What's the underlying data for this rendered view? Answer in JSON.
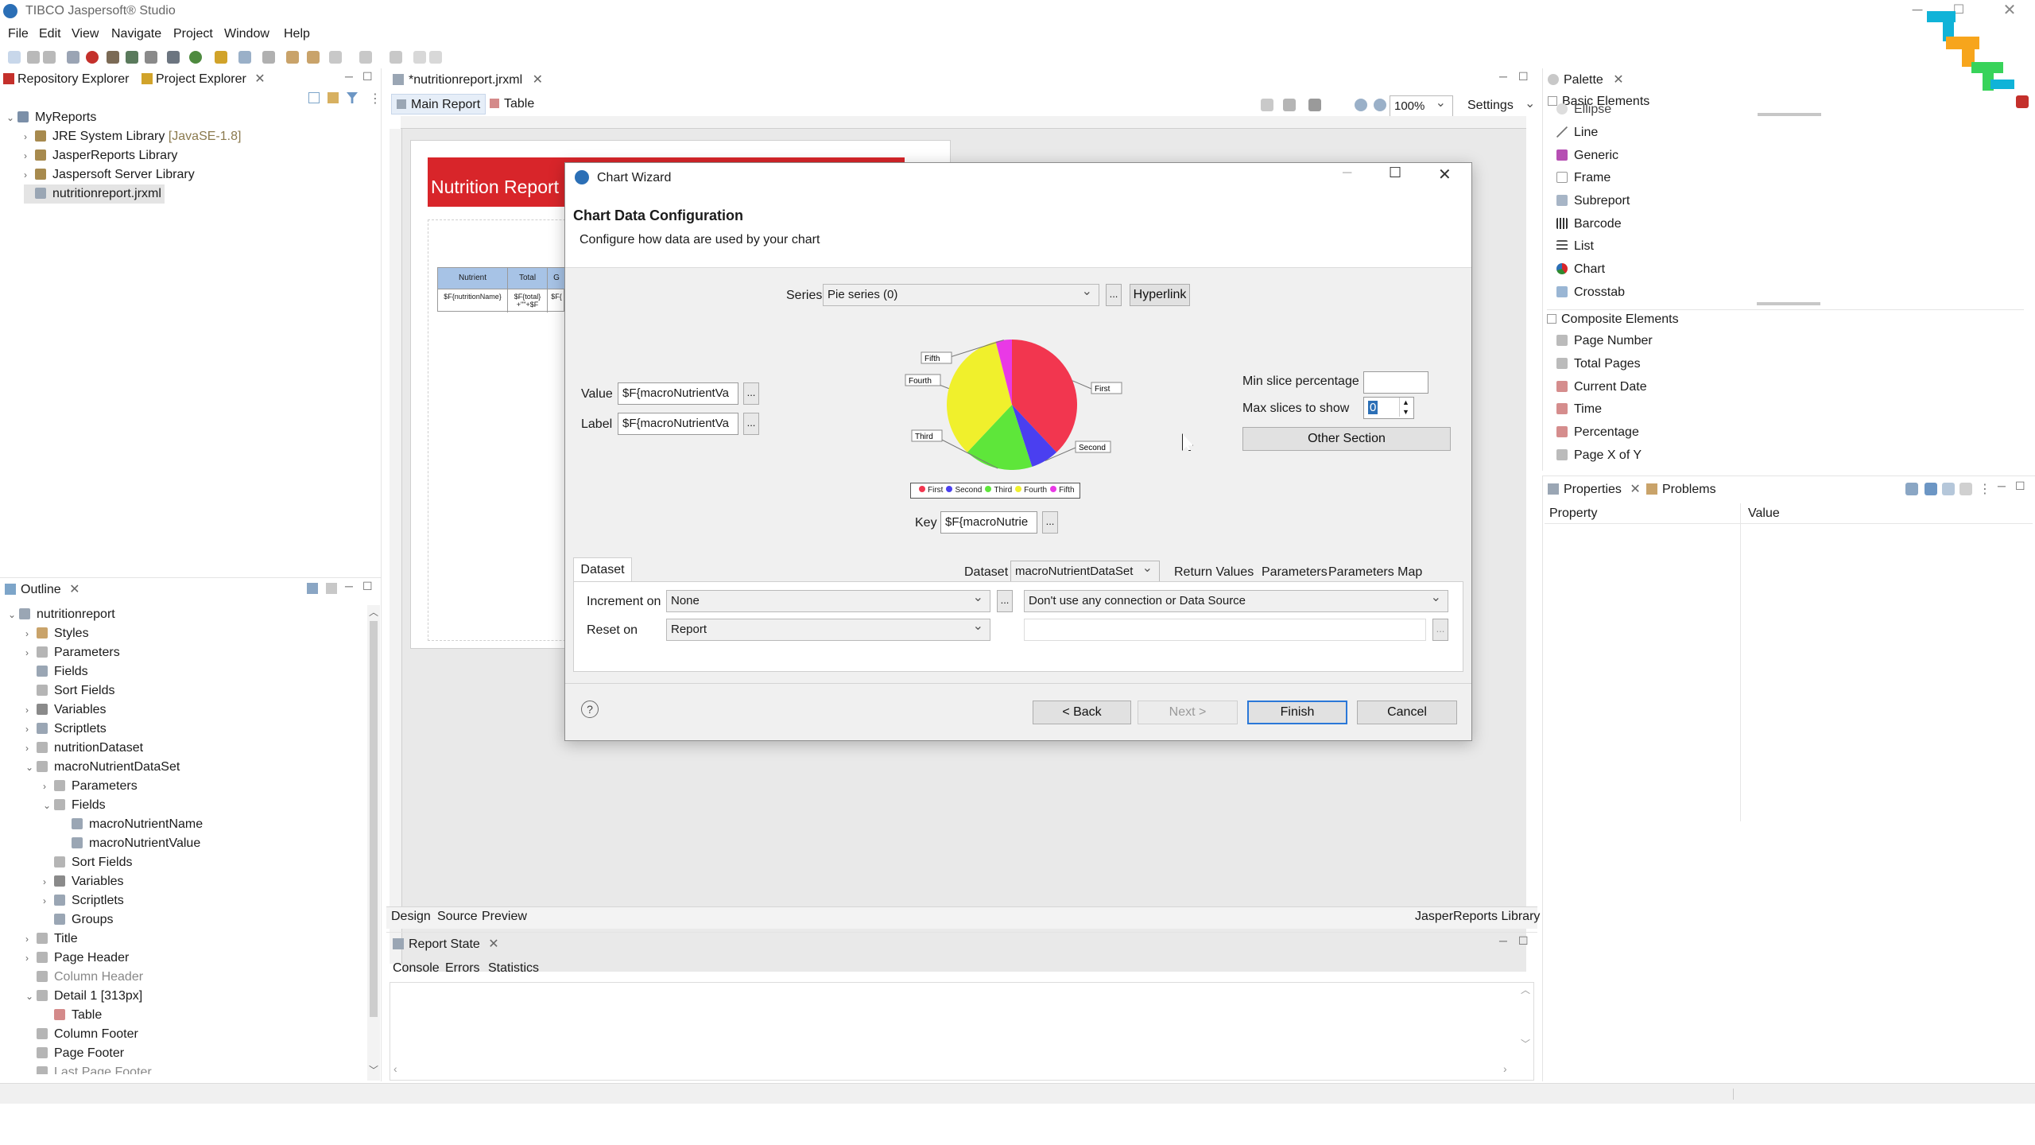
{
  "app": {
    "title": "TIBCO Jaspersoft® Studio",
    "menu": [
      "File",
      "Edit",
      "View",
      "Navigate",
      "Project",
      "Window",
      "Help"
    ]
  },
  "repo_panel": {
    "tabs": [
      "Repository Explorer",
      "Project Explorer"
    ],
    "tree": [
      {
        "label": "MyReports",
        "depth": 0
      },
      {
        "label": "JRE System Library",
        "suffix": "[JavaSE-1.8]",
        "depth": 1
      },
      {
        "label": "JasperReports Library",
        "depth": 1
      },
      {
        "label": "Jaspersoft Server Library",
        "depth": 1
      },
      {
        "label": "nutritionreport.jrxml",
        "depth": 1
      }
    ]
  },
  "outline": {
    "title": "Outline",
    "tree": [
      {
        "label": "nutritionreport",
        "depth": 0
      },
      {
        "label": "Styles",
        "depth": 1
      },
      {
        "label": "Parameters",
        "depth": 1
      },
      {
        "label": "Fields",
        "depth": 1
      },
      {
        "label": "Sort Fields",
        "depth": 1
      },
      {
        "label": "Variables",
        "depth": 1
      },
      {
        "label": "Scriptlets",
        "depth": 1
      },
      {
        "label": "nutritionDataset",
        "depth": 1
      },
      {
        "label": "macroNutrientDataSet",
        "depth": 1
      },
      {
        "label": "Parameters",
        "depth": 2
      },
      {
        "label": "Fields",
        "depth": 2
      },
      {
        "label": "macroNutrientName",
        "depth": 3
      },
      {
        "label": "macroNutrientValue",
        "depth": 3
      },
      {
        "label": "Sort Fields",
        "depth": 2
      },
      {
        "label": "Variables",
        "depth": 2
      },
      {
        "label": "Scriptlets",
        "depth": 2
      },
      {
        "label": "Groups",
        "depth": 2
      },
      {
        "label": "Title",
        "depth": 1
      },
      {
        "label": "Page Header",
        "depth": 1
      },
      {
        "label": "Column Header",
        "depth": 1
      },
      {
        "label": "Detail 1 [313px]",
        "depth": 1
      },
      {
        "label": "Table",
        "depth": 2
      },
      {
        "label": "Column Footer",
        "depth": 1
      },
      {
        "label": "Page Footer",
        "depth": 1
      },
      {
        "label": "Last Page Footer",
        "depth": 1
      }
    ]
  },
  "editor": {
    "file_tab": "*nutritionreport.jrxml",
    "sub_tabs": [
      "Main Report",
      "Table"
    ],
    "zoom": "100%",
    "settings": "Settings",
    "report_title": "Nutrition Report",
    "table_headers": [
      "Nutrient",
      "Total",
      "G"
    ],
    "table_cells": [
      "$F{nutritionName}",
      "$F{total} +\"\"+$F",
      "$F{"
    ],
    "bottom_tabs": [
      "Design",
      "Source",
      "Preview"
    ],
    "library_label": "JasperReports Library"
  },
  "report_state": {
    "title": "Report State",
    "tabs": [
      "Console",
      "Errors",
      "Statistics"
    ]
  },
  "palette": {
    "title": "Palette",
    "basic_title": "Basic Elements",
    "basic_items": [
      "Ellipse",
      "Line",
      "Generic",
      "Frame",
      "Subreport",
      "Barcode",
      "List",
      "Chart",
      "Crosstab"
    ],
    "composite_title": "Composite Elements",
    "composite_items": [
      "Page Number",
      "Total Pages",
      "Current Date",
      "Time",
      "Percentage",
      "Page X of Y"
    ]
  },
  "properties": {
    "tabs": [
      "Properties",
      "Problems"
    ],
    "col_property": "Property",
    "col_value": "Value"
  },
  "wizard": {
    "window_title": "Chart Wizard",
    "heading": "Chart Data Configuration",
    "subheading": "Configure how data are used by your chart",
    "series_label": "Series",
    "series_value": "Pie series (0)",
    "hyperlink": "Hyperlink",
    "value_label": "Value",
    "value_expr": "$F{macroNutrientVa",
    "label_label": "Label",
    "label_expr": "$F{macroNutrientVa",
    "key_label": "Key",
    "key_expr": "$F{macroNutrie",
    "ellipsis": "...",
    "min_slice_label": "Min slice percentage",
    "min_slice_value": "",
    "max_slices_label": "Max slices to show",
    "max_slices_value": "0",
    "other_section": "Other Section",
    "dataset_tab": "Dataset",
    "dataset_label": "Dataset",
    "dataset_value": "macroNutrientDataSet",
    "return_values": "Return Values",
    "parameters": "Parameters",
    "parameters_map": "Parameters Map",
    "increment_label": "Increment on",
    "increment_value": "None",
    "connection_value": "Don't use any connection or Data Source",
    "reset_label": "Reset on",
    "reset_value": "Report",
    "back": "< Back",
    "next": "Next >",
    "finish": "Finish",
    "cancel": "Cancel",
    "help": "?"
  },
  "chart_data": {
    "type": "pie",
    "categories": [
      "First",
      "Second",
      "Third",
      "Fourth",
      "Fifth"
    ],
    "values": [
      38,
      7,
      17,
      34,
      4
    ],
    "colors": [
      "#f2364f",
      "#4a3ff0",
      "#5ee63a",
      "#f0f02c",
      "#e939e6"
    ],
    "legend": "bottom"
  }
}
